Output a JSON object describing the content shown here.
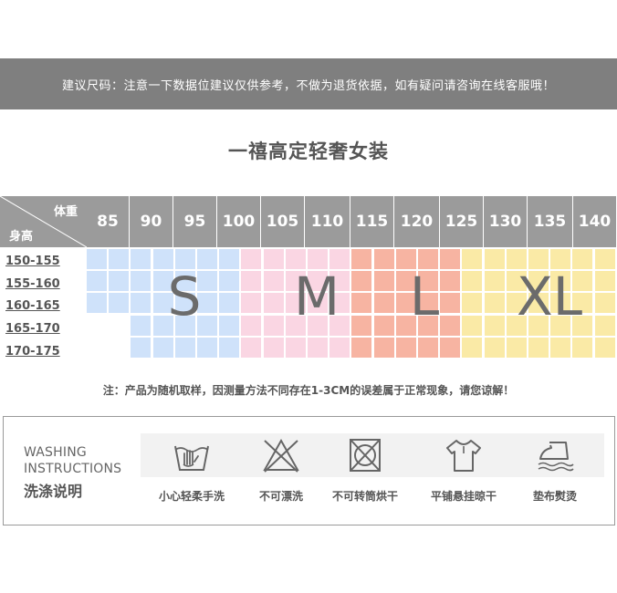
{
  "banner_text": "建议尺码：注意一下数据位建议仅供参考，不做为退货依据，如有疑问请咨询在线客服哦！",
  "title": "一禧高定轻奢女装",
  "table": {
    "weight_header": "体重",
    "height_header": "身高",
    "weights": [
      "85",
      "90",
      "95",
      "100",
      "105",
      "110",
      "115",
      "120",
      "125",
      "130",
      "135",
      "140"
    ],
    "heights": [
      "150-155",
      "155-160",
      "160-165",
      "165-170",
      "170-175"
    ],
    "sizes": [
      "S",
      "M",
      "L",
      "XL"
    ],
    "colors": {
      "S": "#cfe2fa",
      "M": "#fad6e3",
      "L": "#f7b4a2",
      "XL": "#faeaa6",
      "header": "#9b9b9b"
    }
  },
  "note": "注：产品为随机取样，因测量方法不同存在1-3CM的误差属于正常现象，请您谅解！",
  "washing": {
    "title_en_1": "WASHING",
    "title_en_2": "INSTRUCTIONS",
    "title_cn": "洗涤说明",
    "items": [
      {
        "icon": "hand-wash-icon",
        "label": "小心轻柔手洗"
      },
      {
        "icon": "no-bleach-icon",
        "label": "不可漂洗"
      },
      {
        "icon": "no-tumble-dry-icon",
        "label": "不可转筒烘干"
      },
      {
        "icon": "hang-dry-icon",
        "label": "平铺悬挂晾干"
      },
      {
        "icon": "iron-with-cloth-icon",
        "label": "垫布熨烫"
      }
    ]
  }
}
